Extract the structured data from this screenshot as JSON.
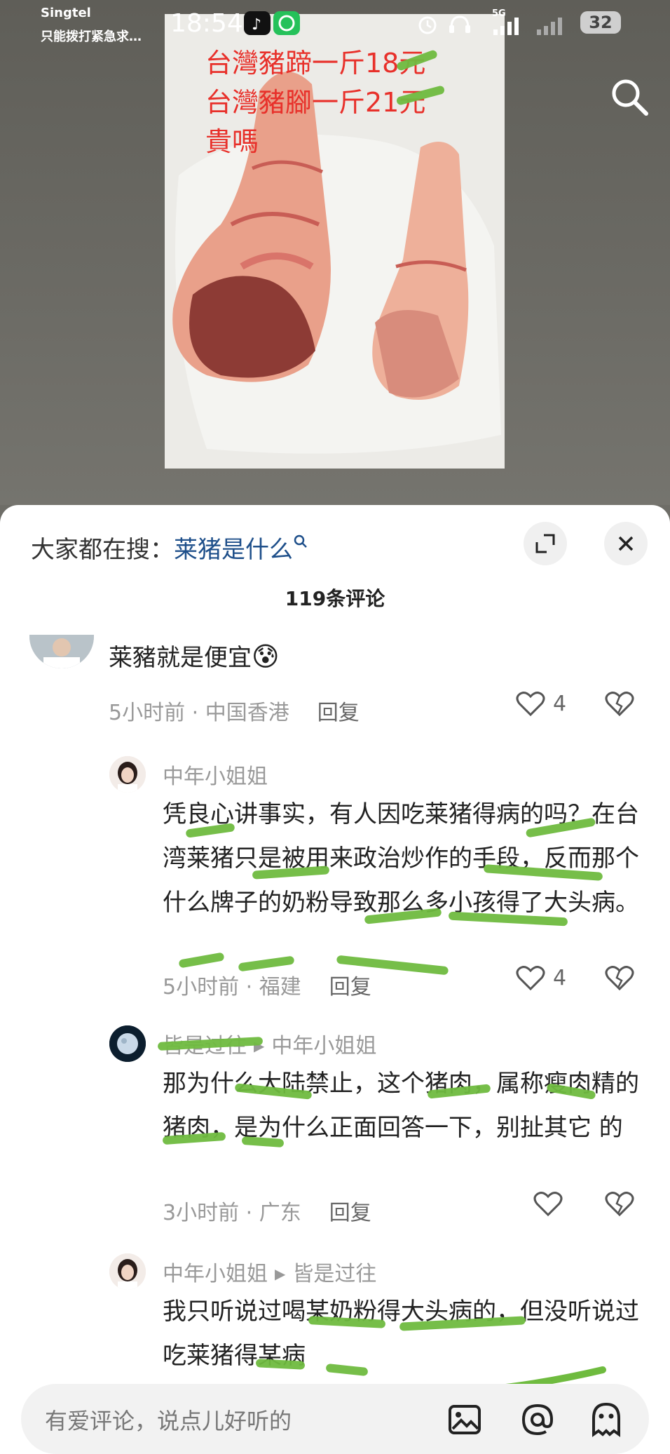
{
  "status_bar": {
    "carrier": "Singtel",
    "carrier_sub": "只能拨打紧急求…",
    "time": "18:54",
    "signal": "5G",
    "battery": "32"
  },
  "post_image": {
    "caption_lines": [
      "台灣豬蹄一斤18元",
      "台灣豬腳一斤21元",
      "貴嗎"
    ]
  },
  "sheet": {
    "trending_label": "大家都在搜：",
    "trending_query": "莱猪是什么",
    "comment_count": "119条评论"
  },
  "comments": [
    {
      "name": "",
      "text": "莱豬就是便宜",
      "time": "5小时前 · 中国香港",
      "reply": "回复",
      "likes": "4"
    },
    {
      "name": "中年小姐姐",
      "text": "凭良心讲事实，有人因吃莱猪得病的吗？在台湾莱猪只是被用来政治炒作的手段，反而那个什么牌子的奶粉导致那么多小孩得了大头病。",
      "time": "5小时前 · 福建",
      "reply": "回复",
      "likes": "4"
    },
    {
      "name": "皆是过往",
      "reply_to": "中年小姐姐",
      "text": "那为什么大陆禁止，这个猪肉，属称瘦肉精的猪肉，是为什么正面回答一下，别扯其它 的",
      "time": "3小时前 · 广东",
      "reply": "回复",
      "likes": ""
    },
    {
      "name": "中年小姐姐",
      "reply_to": "皆是过往",
      "text": "我只听说过喝某奶粉得大头病的，但没听说过吃莱猪得某病"
    }
  ],
  "input": {
    "placeholder": "有爱评论，说点儿好听的"
  },
  "colors": {
    "link": "#1e4f8a",
    "scribble": "#6fbb3f",
    "caption_red": "#e8302a"
  }
}
